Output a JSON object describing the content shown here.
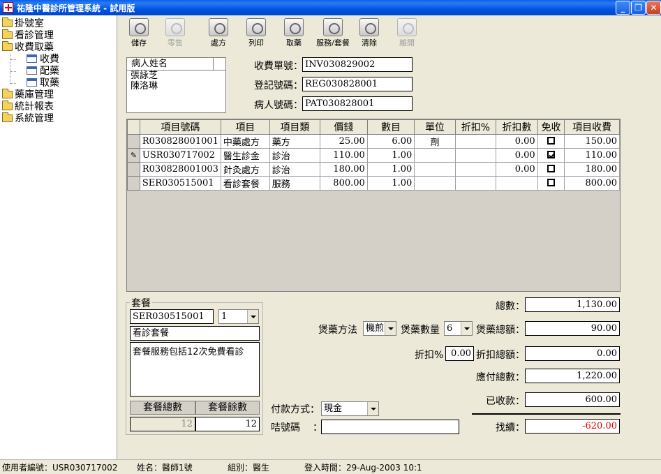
{
  "window": {
    "title": "祐隆中醫診所管理系統 - 試用版"
  },
  "sidebar": {
    "items": [
      {
        "label": "掛號室",
        "type": "folder"
      },
      {
        "label": "看診管理",
        "type": "folder"
      },
      {
        "label": "收費取藥",
        "type": "folder"
      },
      {
        "label": "收費",
        "type": "form"
      },
      {
        "label": "配藥",
        "type": "form"
      },
      {
        "label": "取藥",
        "type": "form"
      },
      {
        "label": "藥庫管理",
        "type": "folder"
      },
      {
        "label": "統計報表",
        "type": "folder"
      },
      {
        "label": "系統管理",
        "type": "folder"
      }
    ]
  },
  "toolbar": {
    "buttons": [
      {
        "label": "儲存",
        "icon": "save-icon",
        "enabled": true
      },
      {
        "label": "零售",
        "icon": "retail-icon",
        "enabled": false
      },
      {
        "label": "處方",
        "icon": "prescription-icon",
        "enabled": true
      },
      {
        "label": "列印",
        "icon": "print-icon",
        "enabled": true
      },
      {
        "label": "取藥",
        "icon": "pickup-icon",
        "enabled": true
      },
      {
        "label": "服務/套餐",
        "icon": "service-icon",
        "enabled": true
      },
      {
        "label": "清除",
        "icon": "clear-icon",
        "enabled": true
      },
      {
        "label": "離開",
        "icon": "exit-icon",
        "enabled": false
      }
    ]
  },
  "patients": {
    "header": "病人姓名",
    "rows": [
      "張詠芝",
      "陳洛琳"
    ]
  },
  "header_fields": {
    "invoice_label": "收費單號：",
    "invoice_value": "INV030829002",
    "reg_label": "登記號碼：",
    "reg_value": "REG030828001",
    "patient_label": "病人號碼：",
    "patient_value": "PAT030828001"
  },
  "grid": {
    "columns": [
      "項目號碼",
      "項目",
      "項目類",
      "價錢",
      "數目",
      "單位",
      "折扣%",
      "折扣數",
      "免收",
      "項目收費"
    ],
    "rows": [
      {
        "marker": "",
        "code": "R030828001001",
        "item": "中藥處方",
        "category": "藥方",
        "price": "25.00",
        "qty": "6.00",
        "unit": "劑",
        "disc_pct": "",
        "disc_amt": "0.00",
        "free": false,
        "charge": "150.00"
      },
      {
        "marker": "✎",
        "code": "USR030717002",
        "item": "醫生診金",
        "category": "診治",
        "price": "110.00",
        "qty": "1.00",
        "unit": "",
        "disc_pct": "",
        "disc_amt": "0.00",
        "free": true,
        "charge": "110.00"
      },
      {
        "marker": "",
        "code": "R030828001003",
        "item": "針灸處方",
        "category": "診治",
        "price": "180.00",
        "qty": "1.00",
        "unit": "",
        "disc_pct": "",
        "disc_amt": "0.00",
        "free": false,
        "charge": "180.00"
      },
      {
        "marker": "",
        "code": "SER030515001",
        "item": "看診套餐",
        "category": "服務",
        "price": "800.00",
        "qty": "1.00",
        "unit": "",
        "disc_pct": "",
        "disc_amt": "",
        "free": false,
        "charge": "800.00"
      }
    ]
  },
  "package": {
    "group_title": "套餐",
    "code": "SER030515001",
    "qty_select": "1",
    "name": "看診套餐",
    "description": "套餐服務包括12次免費看診",
    "total_label": "套餐總數",
    "remain_label": "套餐餘數",
    "total_value": "12",
    "remain_value": "12"
  },
  "summary": {
    "total_label": "總數：",
    "total_value": "1,130.00",
    "decoct_method_label": "煲藥方法",
    "decoct_method_value": "機煎",
    "decoct_qty_label": "煲藥數量",
    "decoct_qty_value": "6",
    "decoct_total_label": "煲藥總額：",
    "decoct_total_value": "90.00",
    "disc_pct_label": "折扣%",
    "disc_pct_value": "0.00",
    "disc_total_label": "折扣總額：",
    "disc_total_value": "0.00",
    "payable_label": "應付總數：",
    "payable_value": "1,220.00",
    "received_label": "已收款：",
    "received_value": "600.00",
    "change_label": "找續：",
    "change_value": "-620.00",
    "payment_label": "付款方式：",
    "payment_value": "現金",
    "card_label": "咭號碼",
    "card_colon": "：",
    "card_value": ""
  },
  "statusbar": {
    "user_id": "使用者編號：USR030717002",
    "name": "姓名：醫師1號",
    "group": "組別：醫生",
    "login": "登入時間：29-Aug-2003 10:1"
  }
}
